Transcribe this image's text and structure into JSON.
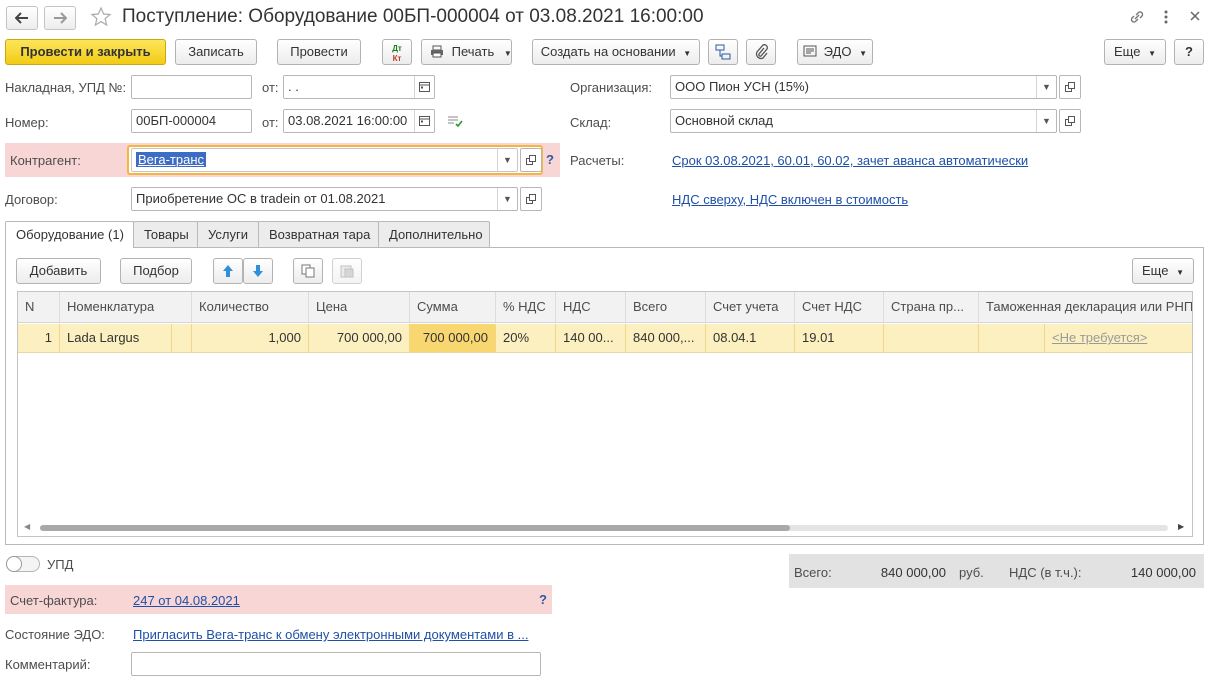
{
  "window": {
    "title": "Поступление: Оборудование 00БП-000004 от 03.08.2021 16:00:00",
    "back_icon": "arrow-left-icon",
    "forward_icon": "arrow-right-icon",
    "star_icon": "star-icon",
    "link_icon": "link-icon",
    "more_icon": "vertical-dots-icon",
    "close_icon": "close-icon"
  },
  "toolbar": {
    "post_close": "Провести и закрыть",
    "save": "Записать",
    "post": "Провести",
    "dt_kt_top": "Дт",
    "dt_kt_bottom": "Кт",
    "print": "Печать",
    "create_based": "Создать на основании",
    "edo": "ЭДО",
    "more": "Еще",
    "help": "?"
  },
  "header": {
    "invoice_label": "Накладная, УПД №:",
    "invoice_value": "",
    "from1_label": "от:",
    "from1_value": " .  .",
    "number_label": "Номер:",
    "number_value": "00БП-000004",
    "from2_label": "от:",
    "from2_value": "03.08.2021 16:00:00",
    "counterparty_label": "Контрагент:",
    "counterparty_value": "Вега-транс",
    "counterparty_help": "?",
    "contract_label": "Договор:",
    "contract_value": "Приобретение ОС в tradein от 01.08.2021",
    "org_label": "Организация:",
    "org_value": "ООО Пион УСН (15%)",
    "warehouse_label": "Склад:",
    "warehouse_value": "Основной склад",
    "settlements_label": "Расчеты:",
    "settlements_link": "Срок 03.08.2021, 60.01, 60.02, зачет аванса автоматически",
    "vat_link": "НДС сверху, НДС включен в стоимость"
  },
  "tabs": [
    {
      "label": "Оборудование (1)",
      "active": true
    },
    {
      "label": "Товары",
      "active": false
    },
    {
      "label": "Услуги",
      "active": false
    },
    {
      "label": "Возвратная тара",
      "active": false
    },
    {
      "label": "Дополнительно",
      "active": false
    }
  ],
  "table_toolbar": {
    "add": "Добавить",
    "select": "Подбор",
    "more": "Еще"
  },
  "table": {
    "columns": [
      "N",
      "Номенклатура",
      "Количество",
      "Цена",
      "Сумма",
      "% НДС",
      "НДС",
      "Всего",
      "Счет учета",
      "Счет НДС",
      "Страна пр...",
      "Таможенная декларация или РНПТ"
    ],
    "rows": [
      {
        "n": "1",
        "nomenclature": "Lada Largus",
        "qty": "1,000",
        "price": "700 000,00",
        "sum": "700 000,00",
        "vat_rate": "20%",
        "vat": "140 00...",
        "total": "840 000,...",
        "account": "08.04.1",
        "vat_account": "19.01",
        "country": "",
        "customs": "<Не требуется>"
      }
    ]
  },
  "footer": {
    "upd_label": "УПД",
    "total_label": "Всего:",
    "total_value": "840 000,00",
    "currency": "руб.",
    "vat_label": "НДС (в т.ч.):",
    "vat_value": "140 000,00",
    "invoice_label": "Счет-фактура:",
    "invoice_link": "247 от 04.08.2021",
    "invoice_help": "?",
    "edo_state_label": "Состояние ЭДО:",
    "edo_state_link": "Пригласить Вега-транс к обмену электронными документами в ...",
    "comment_label": "Комментарий:",
    "comment_value": ""
  },
  "colors": {
    "primary_button": "#f3cb15",
    "highlight_row": "#fcf0c0",
    "required_field": "#f9d6d6",
    "link": "#1e50a8",
    "totals_panel": "#e2e2e2"
  }
}
